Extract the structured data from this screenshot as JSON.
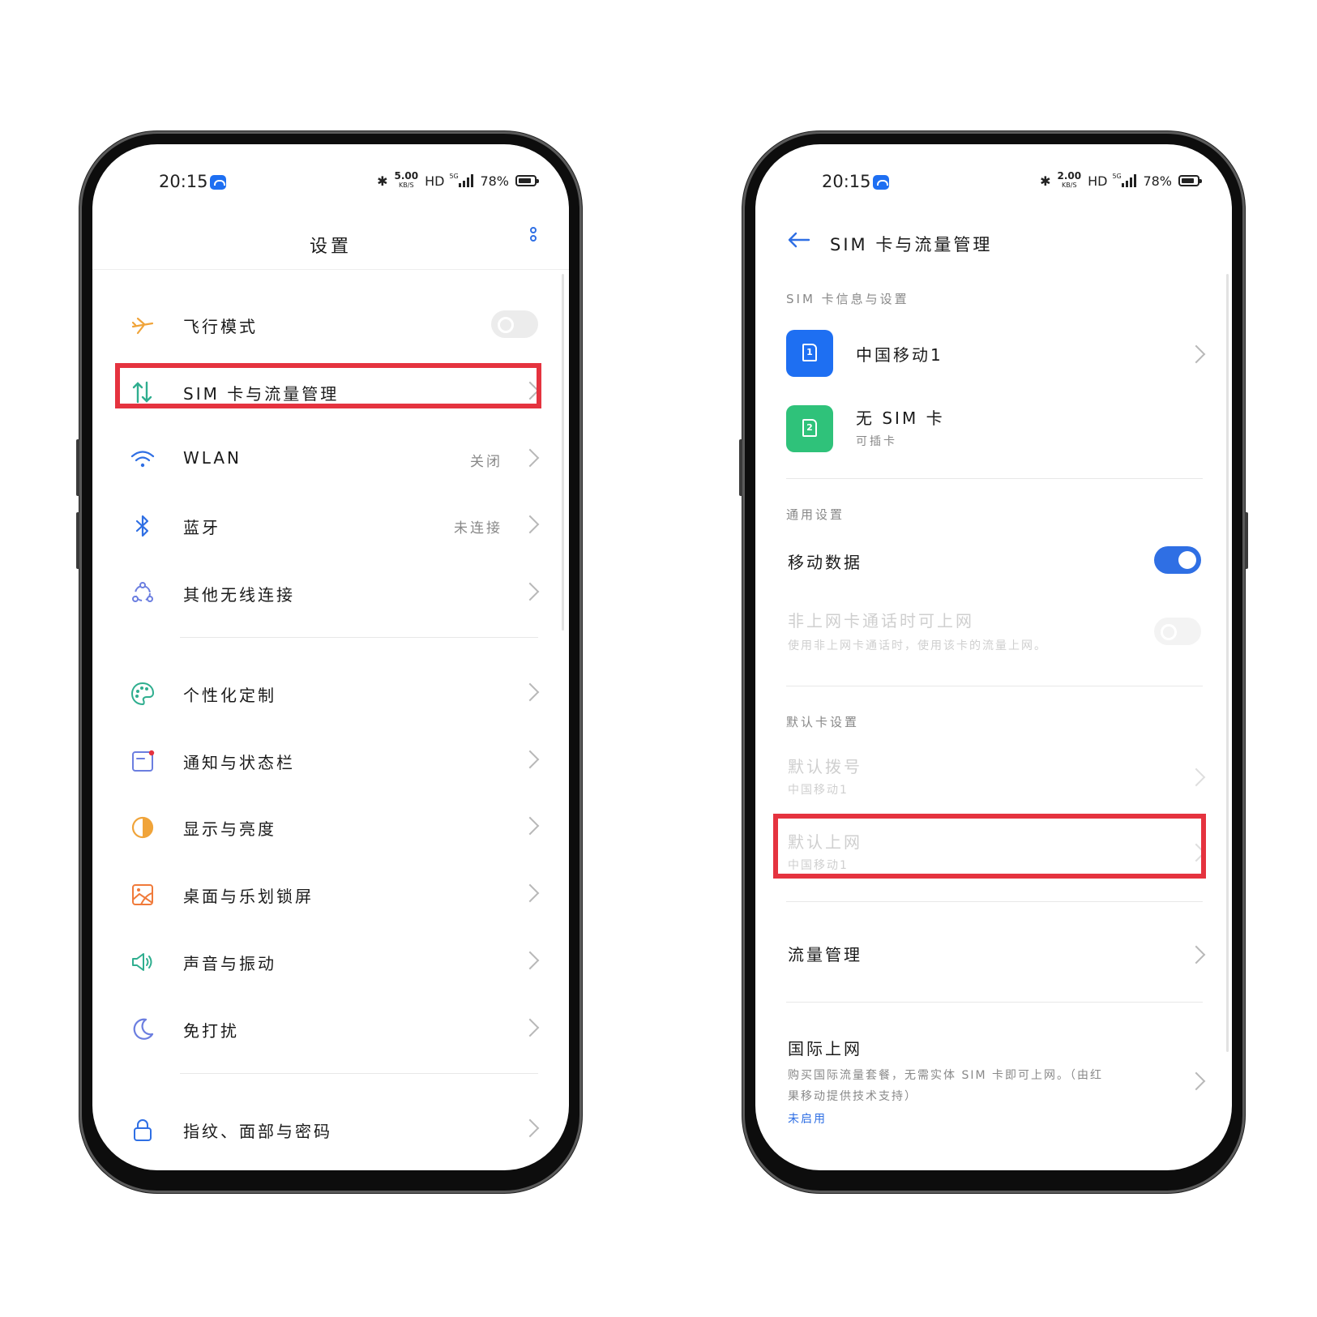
{
  "status_left": {
    "time": "20:15",
    "speed_value": "5.00",
    "speed_unit": "KB/S",
    "hd": "HD",
    "net": "5G",
    "battery": "78%"
  },
  "status_right": {
    "time": "20:15",
    "speed_value": "2.00",
    "speed_unit": "KB/S",
    "hd": "HD",
    "net": "5G",
    "battery": "78%"
  },
  "settings": {
    "title": "设置",
    "items": [
      {
        "label": "飞行模式",
        "icon": "airplane-icon"
      },
      {
        "label": "SIM 卡与流量管理",
        "icon": "data-transfer-icon"
      },
      {
        "label": "WLAN",
        "value": "关闭",
        "icon": "wifi-icon"
      },
      {
        "label": "蓝牙",
        "value": "未连接",
        "icon": "bluetooth-icon"
      },
      {
        "label": "其他无线连接",
        "icon": "wireless-connections-icon"
      },
      {
        "label": "个性化定制",
        "icon": "palette-icon"
      },
      {
        "label": "通知与状态栏",
        "icon": "notification-icon"
      },
      {
        "label": "显示与亮度",
        "icon": "brightness-icon"
      },
      {
        "label": "桌面与乐划锁屏",
        "icon": "wallpaper-icon"
      },
      {
        "label": "声音与振动",
        "icon": "speaker-icon"
      },
      {
        "label": "免打扰",
        "icon": "moon-icon"
      },
      {
        "label": "指纹、面部与密码",
        "icon": "lock-icon"
      }
    ]
  },
  "sim": {
    "title": "SIM 卡与流量管理",
    "section_info": "SIM 卡信息与设置",
    "sim1": {
      "number": "1",
      "label": "中国移动1",
      "color": "#1e6ff2"
    },
    "sim2": {
      "number": "2",
      "label": "无 SIM 卡",
      "sub": "可插卡",
      "color": "#2fc27a"
    },
    "section_general": "通用设置",
    "mobile_data": "移动数据",
    "call_data": {
      "label": "非上网卡通话时可上网",
      "sub": "使用非上网卡通话时，使用该卡的流量上网。"
    },
    "section_default": "默认卡设置",
    "default_call": {
      "label": "默认拨号",
      "sub": "中国移动1"
    },
    "default_data": {
      "label": "默认上网",
      "sub": "中国移动1"
    },
    "traffic": "流量管理",
    "intl": {
      "label": "国际上网",
      "desc_line1": "购买国际流量套餐，无需实体 SIM 卡即可上网。（由红",
      "desc_line2": "果移动提供技术支持）",
      "status": "未启用"
    }
  },
  "colors": {
    "accent": "#2f6fe4",
    "highlight": "#e5333f"
  }
}
